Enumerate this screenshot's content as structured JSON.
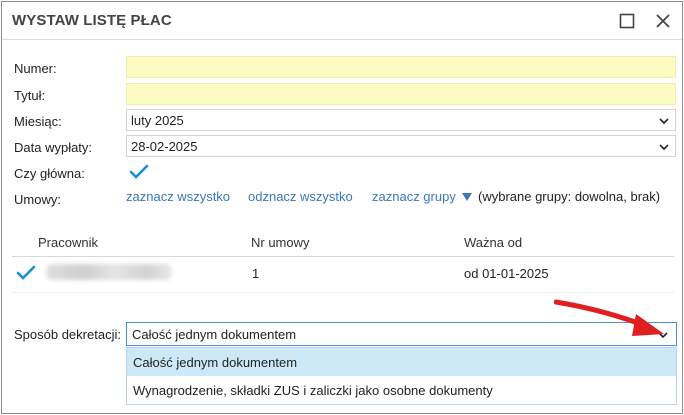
{
  "window": {
    "title": "WYSTAW LISTĘ PŁAC",
    "maximize_icon": "maximize-icon",
    "close_icon": "close-icon"
  },
  "form": {
    "numer_label": "Numer:",
    "numer_value": "",
    "tytul_label": "Tytuł:",
    "tytul_value": "",
    "miesiac_label": "Miesiąc:",
    "miesiac_value": "luty 2025",
    "data_label": "Data wypłaty:",
    "data_value": "28-02-2025",
    "glowna_label": "Czy główna:",
    "glowna_checked": true,
    "umowy_label": "Umowy:"
  },
  "links": {
    "select_all": "zaznacz wszystko",
    "deselect_all": "odznacz wszystko",
    "select_groups": "zaznacz grupy",
    "groups_info": "(wybrane grupy: dowolna, brak)"
  },
  "table": {
    "columns": [
      "Pracownik",
      "Nr umowy",
      "Ważna od"
    ],
    "rows": [
      {
        "checked": true,
        "nr_umowy": "1",
        "wazna_od": "od 01-01-2025"
      }
    ]
  },
  "dekretacja": {
    "label": "Sposób dekretacji:",
    "value": "Całość jednym dokumentem",
    "options": [
      "Całość jednym dokumentem",
      "Wynagrodzenie, składki ZUS i zaliczki jako osobne dokumenty"
    ],
    "selected_index": 0
  },
  "colors": {
    "accent": "#4a90d9",
    "check": "#1a8fd8",
    "link": "#3a78b8",
    "highlight_field": "#fdfbc4",
    "dropdown_selected": "#cde8f6",
    "annotation_arrow": "#e02020"
  }
}
